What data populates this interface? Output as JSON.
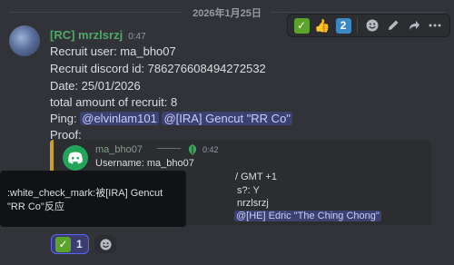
{
  "date_divider": "2026年1月25日",
  "action_bar": {
    "check_emoji": "✓",
    "thumbs_emoji": "👍",
    "two_emoji": "2"
  },
  "message": {
    "username": "[RC] mrzlsrzj",
    "timestamp": "0:47",
    "lines": {
      "recruit_user": "Recruit user: ma_bho07",
      "recruit_id": "Recruit discord id: 786276608494272532",
      "date": "Date:  25/01/2026",
      "total": "total amount of recruit: 8",
      "ping_label": "Ping: ",
      "mention1": "@elvinlam101",
      "mention2": "@[IRA] Gencut \"RR Co\"",
      "proof": "Proof:"
    }
  },
  "embed": {
    "name": "ma_bho07",
    "time": "0:42",
    "lines": [
      "Username: ma_bho07",
      "/ GMT +1",
      "s?: Y",
      "nrzlsrzj"
    ],
    "mention": "@[HE] Edric \"The Ching Chong\""
  },
  "tooltip": {
    "line1": ":white_check_mark:被[IRA] Gencut",
    "line2": "\"RR Co\"反应"
  },
  "reaction": {
    "emoji": "✓",
    "count": "1"
  },
  "colors": {
    "background": "#323339",
    "username": "#4fa866",
    "mention_bg": "#3c4270",
    "embed_bar": "#c9a227",
    "reaction_border": "#5865f2"
  }
}
